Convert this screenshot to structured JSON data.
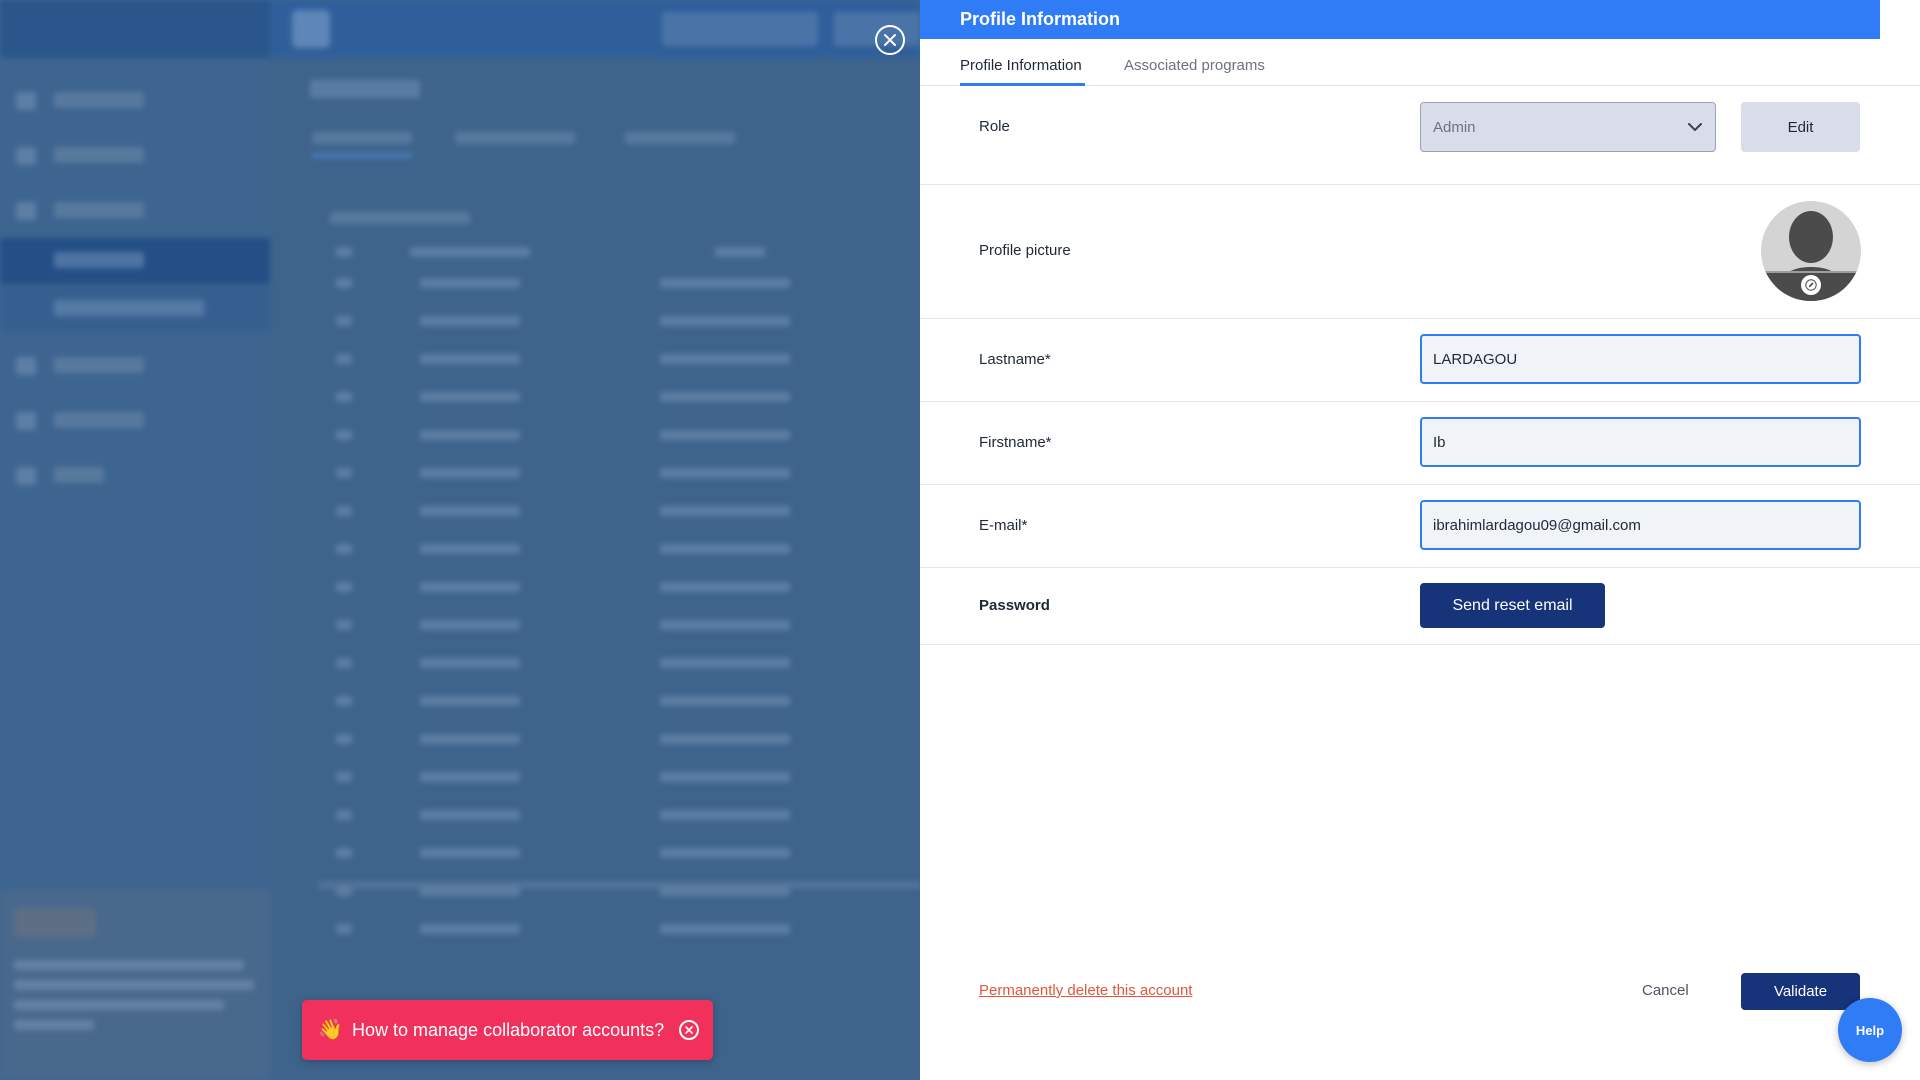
{
  "overlay": {
    "close_icon": "close-circle-icon"
  },
  "toast": {
    "emoji": "👋",
    "message": "How to manage collaborator accounts?",
    "close_icon": "close-circle-icon"
  },
  "panel": {
    "title": "Profile Information",
    "tabs": [
      {
        "label": "Profile Information",
        "active": true
      },
      {
        "label": "Associated programs",
        "active": false
      }
    ],
    "role": {
      "label": "Role",
      "selected": "Admin",
      "edit_label": "Edit"
    },
    "profile_picture": {
      "label": "Profile picture",
      "edit_icon": "pencil-icon"
    },
    "lastname": {
      "label": "Lastname*",
      "value": "LARDAGOU"
    },
    "firstname": {
      "label": "Firstname*",
      "value": "Ib"
    },
    "email": {
      "label": "E-mail*",
      "value": "ibrahimlardagou09@gmail.com"
    },
    "password": {
      "label": "Password",
      "button_label": "Send reset email"
    },
    "footer": {
      "delete_label": "Permanently delete this account",
      "cancel_label": "Cancel",
      "validate_label": "Validate"
    },
    "help_label": "Help"
  },
  "colors": {
    "accent": "#2f7cf6",
    "primary": "#17337a",
    "danger": "#e2573a",
    "toast": "#f1315c"
  }
}
